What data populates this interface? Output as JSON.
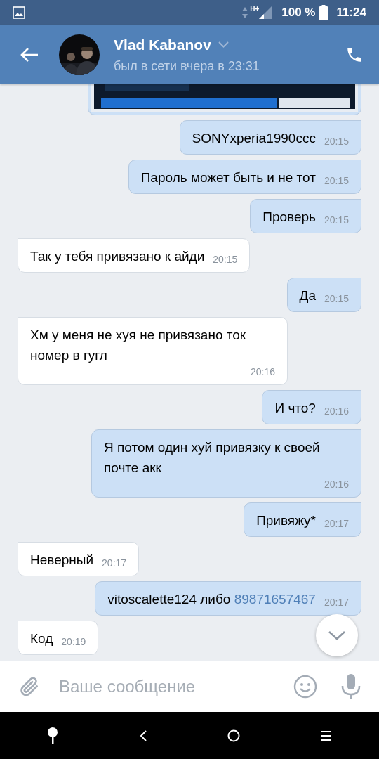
{
  "status_bar": {
    "network": "H+",
    "battery": "100 %",
    "time": "11:24"
  },
  "header": {
    "name": "Vlad Kabanov",
    "status": "был в сети вчера в 23:31"
  },
  "messages": [
    {
      "kind": "picture",
      "outgoing": true
    },
    {
      "kind": "text",
      "outgoing": true,
      "text": "SONYxperia1990ccc",
      "time": "20:15"
    },
    {
      "kind": "text",
      "outgoing": true,
      "text": "Пароль может быть и не тот",
      "time": "20:15"
    },
    {
      "kind": "text",
      "outgoing": true,
      "text": "Проверь",
      "time": "20:15"
    },
    {
      "kind": "text",
      "outgoing": false,
      "text": "Так у тебя привязано к айди",
      "time": "20:15"
    },
    {
      "kind": "text",
      "outgoing": true,
      "text": "Да",
      "time": "20:15"
    },
    {
      "kind": "text",
      "outgoing": false,
      "text": "Хм у меня не хуя не привязано ток номер в гугл",
      "time": "20:16"
    },
    {
      "kind": "text",
      "outgoing": true,
      "text": "И что?",
      "time": "20:16"
    },
    {
      "kind": "text",
      "outgoing": true,
      "text": "Я потом один хуй привязку к своей почте акк",
      "time": "20:16"
    },
    {
      "kind": "text",
      "outgoing": true,
      "text": "Привяжу*",
      "time": "20:17"
    },
    {
      "kind": "text",
      "outgoing": false,
      "text": "Неверный",
      "time": "20:17"
    },
    {
      "kind": "text",
      "outgoing": true,
      "text": "vitoscalette124 либо",
      "link": "89871657467",
      "time": "20:17"
    },
    {
      "kind": "text",
      "outgoing": false,
      "text": "Код",
      "time": "20:19"
    }
  ],
  "composer": {
    "placeholder": "Ваше сообщение"
  }
}
